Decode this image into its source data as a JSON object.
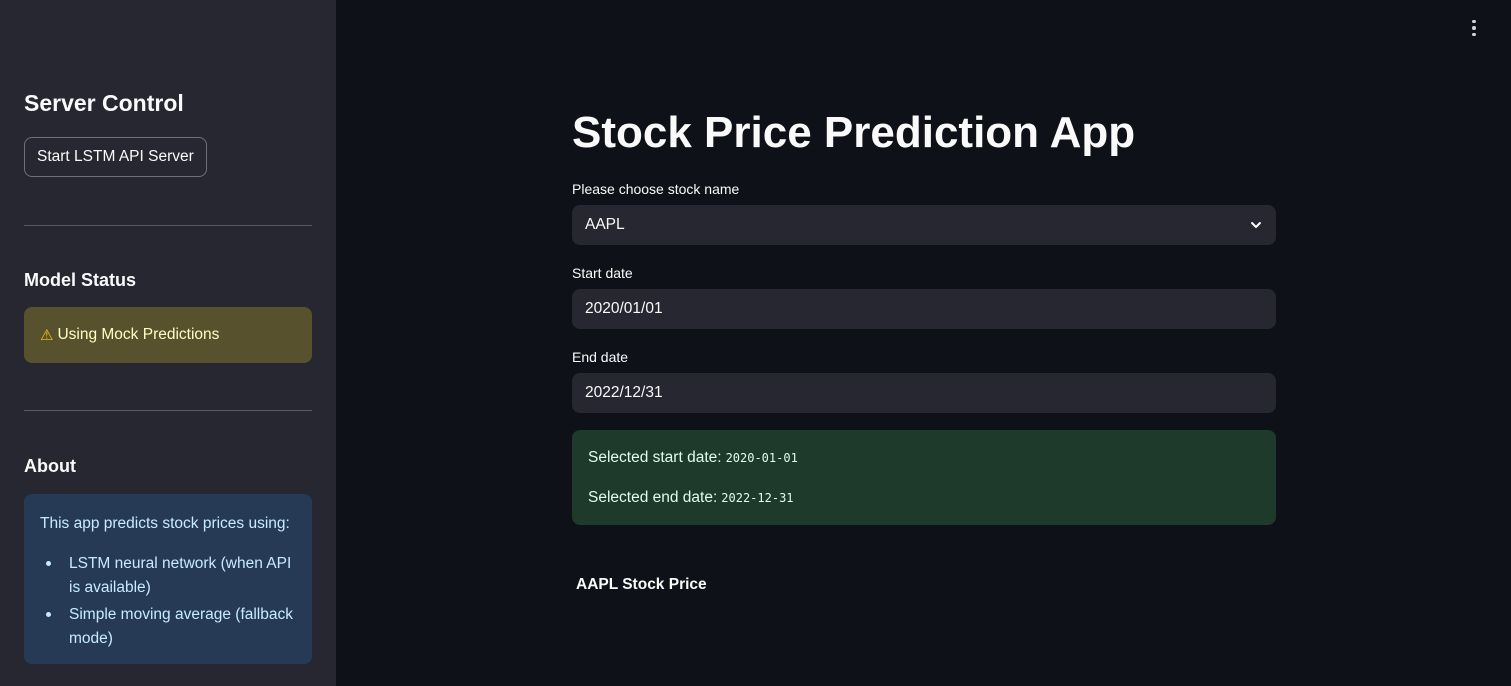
{
  "sidebar": {
    "server_control_title": "Server Control",
    "start_button_label": "Start LSTM API Server",
    "model_status_title": "Model Status",
    "model_status_message": "Using Mock Predictions",
    "about_title": "About",
    "about_intro": "This app predicts stock prices using:",
    "about_items": [
      "LSTM neural network (when API is available)",
      "Simple moving average (fallback mode)"
    ]
  },
  "main": {
    "page_title": "Stock Price Prediction App",
    "stock_label": "Please choose stock name",
    "stock_value": "AAPL",
    "start_label": "Start date",
    "start_value": "2020/01/01",
    "end_label": "End date",
    "end_value": "2022/12/31",
    "selected_start_label": "Selected start date:",
    "selected_start_value": "2020-01-01",
    "selected_end_label": "Selected end date:",
    "selected_end_value": "2022-12-31",
    "chart_title": "AAPL Stock Price"
  },
  "icons": {
    "warning": "warning-icon",
    "menu": "kebab-menu-icon",
    "dropdown": "chevron-down-icon"
  },
  "colors": {
    "background": "#0e1117",
    "sidebar": "#262730",
    "warning_bg": "#57512e",
    "info_bg": "#263a55",
    "success_bg": "#1d3a2a"
  }
}
